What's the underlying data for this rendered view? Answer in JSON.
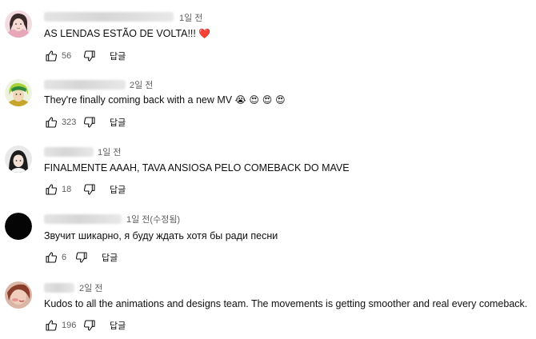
{
  "comments": [
    {
      "time": "1일 전",
      "text": "AS LENDAS ESTÃO DE VOLTA!!! ",
      "emoji": "❤️",
      "likes": "56",
      "reply_label": "답글"
    },
    {
      "time": "2일 전",
      "text": "They're finally coming back with a new MV ",
      "emoji": "😭 😍 😍 😍",
      "likes": "323",
      "reply_label": "답글"
    },
    {
      "time": "1일 전",
      "text": "FINALMENTE AAAH, TAVA ANSIOSA PELO COMEBACK DO MAVE",
      "emoji": "",
      "likes": "18",
      "reply_label": "답글"
    },
    {
      "time": "1일 전(수정됨)",
      "text": "Звучит шикарно, я буду ждать хотя бы ради песни",
      "emoji": "",
      "likes": "6",
      "reply_label": "답글"
    },
    {
      "time": "2일 전",
      "text": "Kudos to all the animations and designs team. The movements is getting smoother and real every comeback.",
      "emoji": "",
      "likes": "196",
      "reply_label": "답글"
    }
  ],
  "icons": {
    "like": "thumbs-up-icon",
    "dislike": "thumbs-down-icon"
  },
  "colors": {
    "text": "#0f0f0f",
    "secondary": "#606060",
    "heart": "#e0245e"
  }
}
